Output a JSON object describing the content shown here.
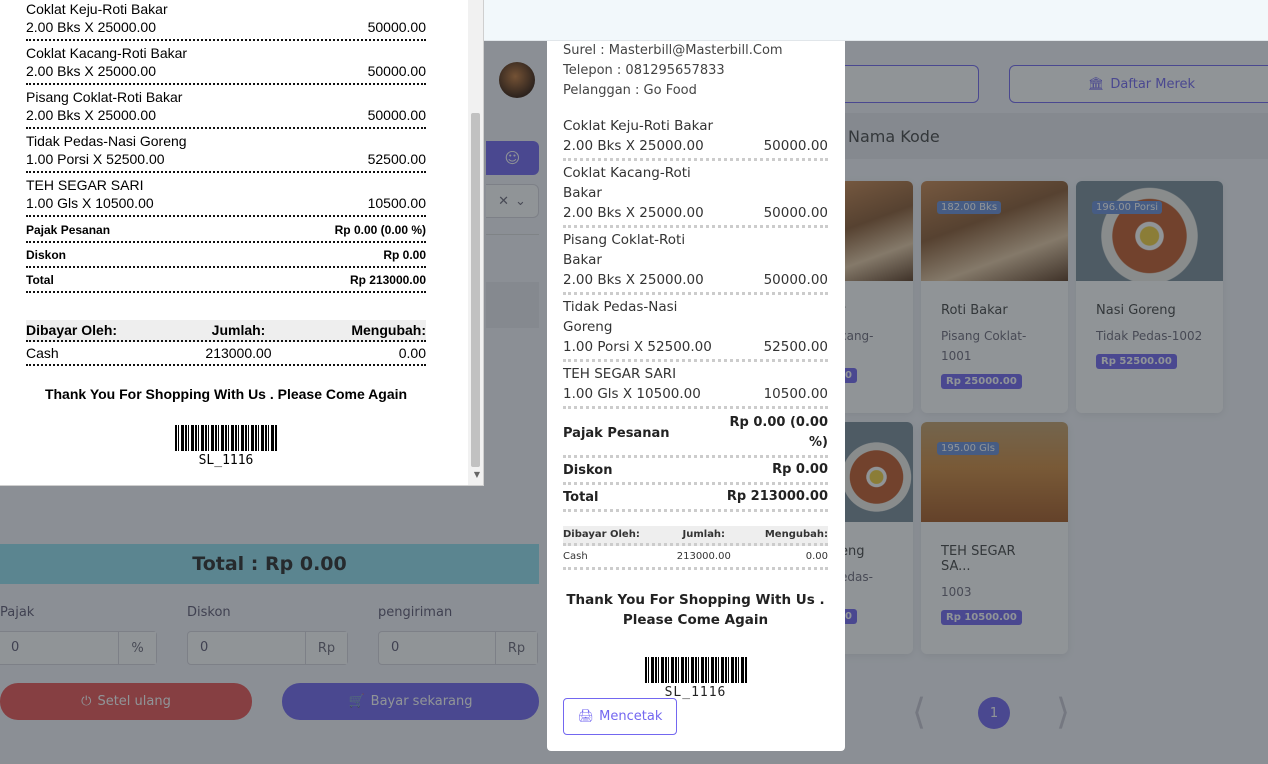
{
  "colors": {
    "accent": "#7367f0",
    "danger": "#ea5455",
    "total_bar": "#95e0f0"
  },
  "app": {
    "daftar_merek": "Daftar Merek",
    "search_placeholder_visible": "Nama Kode",
    "total": "Total : Rp 0.00",
    "fields": {
      "pajak_label": "Pajak",
      "pajak_value": "0",
      "pajak_suffix": "%",
      "diskon_label": "Diskon",
      "diskon_value": "0",
      "diskon_suffix": "Rp",
      "pengiriman_label": "pengiriman",
      "pengiriman_value": "0",
      "pengiriman_suffix": "Rp"
    },
    "reset_label": "Setel ulang",
    "pay_label": "Bayar sekarang",
    "page_number": "1",
    "products": [
      {
        "stock": "182.00 Bks",
        "name": "Roti Bakar",
        "sub": "Pisang Coklat-1001",
        "price": "Rp 25000.00"
      },
      {
        "stock": "196.00 Porsi",
        "name": "Nasi Goreng",
        "sub": "Tidak Pedas-1002",
        "price": "Rp 52500.00"
      },
      {
        "stock": "195.00 Gls",
        "name": "TEH SEGAR SA...",
        "sub": "1003",
        "price": "Rp 10500.00"
      }
    ],
    "partial_cards": [
      {
        "name": "r",
        "sub": "cang-",
        "price": "0"
      },
      {
        "name": "eng",
        "sub": "edas-",
        "price": "0"
      }
    ]
  },
  "preview": {
    "items": [
      {
        "name": "Coklat Keju-Roti Bakar",
        "qty": "2.00 Bks X 25000.00",
        "total": "50000.00"
      },
      {
        "name": "Coklat Kacang-Roti Bakar",
        "qty": "2.00 Bks X 25000.00",
        "total": "50000.00"
      },
      {
        "name": "Pisang Coklat-Roti Bakar",
        "qty": "2.00 Bks X 25000.00",
        "total": "50000.00"
      },
      {
        "name": "Tidak Pedas-Nasi Goreng",
        "qty": "1.00 Porsi X 52500.00",
        "total": "52500.00"
      },
      {
        "name": "TEH SEGAR SARI",
        "qty": "1.00 Gls X 10500.00",
        "total": "10500.00"
      }
    ],
    "pajak_label": "Pajak Pesanan",
    "pajak_value": "Rp 0.00 (0.00 %)",
    "diskon_label": "Diskon",
    "diskon_value": "Rp 0.00",
    "total_label": "Total",
    "total_value": "Rp 213000.00",
    "pay_head": [
      "Dibayar Oleh:",
      "Jumlah:",
      "Mengubah:"
    ],
    "pay_row": [
      "Cash",
      "213000.00",
      "0.00"
    ],
    "thanks": "Thank You For Shopping With Us . Please Come Again",
    "code": "SL_1116"
  },
  "receipt": {
    "surel": "Surel : Masterbill@Masterbill.Com",
    "telepon": "Telepon : 081295657833",
    "pelanggan": "Pelanggan : Go Food",
    "items": [
      {
        "name": "Coklat Keju-Roti Bakar",
        "qty": "2.00 Bks X 25000.00",
        "total": "50000.00"
      },
      {
        "name": "Coklat Kacang-Roti Bakar",
        "qty": "2.00 Bks X 25000.00",
        "total": "50000.00"
      },
      {
        "name": "Pisang Coklat-Roti Bakar",
        "qty": "2.00 Bks X 25000.00",
        "total": "50000.00"
      },
      {
        "name": "Tidak Pedas-Nasi Goreng",
        "qty": "1.00 Porsi X 52500.00",
        "total": "52500.00"
      },
      {
        "name": "TEH SEGAR SARI",
        "qty": "1.00 Gls X 10500.00",
        "total": "10500.00"
      }
    ],
    "pajak_label": "Pajak Pesanan",
    "pajak_value": "Rp 0.00 (0.00 %)",
    "diskon_label": "Diskon",
    "diskon_value": "Rp 0.00",
    "total_label": "Total",
    "total_value": "Rp 213000.00",
    "pay_head": [
      "Dibayar Oleh:",
      "Jumlah:",
      "Mengubah:"
    ],
    "pay_row": [
      "Cash",
      "213000.00",
      "0.00"
    ],
    "thanks": "Thank You For Shopping With Us . Please Come Again",
    "code": "SL_1116",
    "print_label": "Mencetak"
  }
}
